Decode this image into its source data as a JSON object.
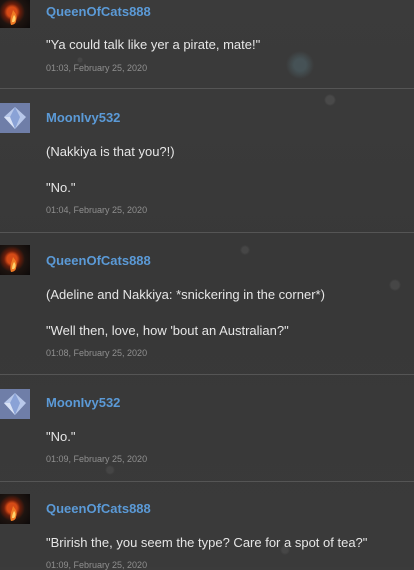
{
  "posts": [
    {
      "author": "QueenOfCats888",
      "avatar": "fire-avatar",
      "lines": [
        "\"Ya could talk like yer a pirate, mate!\""
      ],
      "time": "01:03, February 25, 2020"
    },
    {
      "author": "MoonIvy532",
      "avatar": "crystal-avatar",
      "lines": [
        "(Nakkiya is that you?!)",
        "\"No.\""
      ],
      "time": "01:04, February 25, 2020"
    },
    {
      "author": "QueenOfCats888",
      "avatar": "fire-avatar",
      "lines": [
        "(Adeline and Nakkiya: *snickering in the corner*)",
        "\"Well then, love, how 'bout an Australian?\""
      ],
      "time": "01:08, February 25, 2020"
    },
    {
      "author": "MoonIvy532",
      "avatar": "crystal-avatar",
      "lines": [
        "\"No.\""
      ],
      "time": "01:09, February 25, 2020"
    },
    {
      "author": "QueenOfCats888",
      "avatar": "fire-avatar",
      "lines": [
        "\"Brirish the, you seem the type? Care for a spot of tea?\""
      ],
      "time": "01:09, February 25, 2020"
    }
  ],
  "colors": {
    "username": "#5b9ad7",
    "message": "#e6e6e6",
    "timestamp": "#8f8f8f",
    "background": "#3a3a3a",
    "divider": "#555555"
  }
}
